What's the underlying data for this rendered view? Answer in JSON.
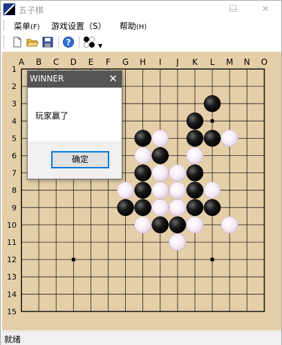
{
  "window": {
    "title": "五子棋",
    "minimize_glyph": "—",
    "maximize_glyph": "☐",
    "close_glyph": "✕"
  },
  "menubar": {
    "items": [
      {
        "label": "菜单",
        "accel": "(F)"
      },
      {
        "label": "游戏设置（S）",
        "accel": ""
      },
      {
        "label": "帮助",
        "accel": "(H)"
      }
    ]
  },
  "toolbar": {
    "buttons": [
      "new-file-icon",
      "open-folder-icon",
      "save-disk-icon",
      "help-icon",
      "gomoku-pieces-icon"
    ]
  },
  "board": {
    "columns": [
      "A",
      "B",
      "C",
      "D",
      "E",
      "F",
      "G",
      "H",
      "I",
      "J",
      "K",
      "L",
      "M",
      "N",
      "O"
    ],
    "rows": [
      "1",
      "2",
      "3",
      "4",
      "5",
      "6",
      "7",
      "8",
      "9",
      "10",
      "11",
      "12",
      "13",
      "14",
      "15"
    ],
    "star_points": [
      "D4",
      "L4",
      "D12",
      "L12"
    ],
    "black_stones": [
      "L3",
      "K4",
      "H5",
      "K5",
      "L5",
      "I6",
      "H7",
      "K7",
      "H8",
      "K8",
      "G9",
      "H9",
      "K9",
      "L9",
      "I10",
      "J10"
    ],
    "white_stones": [
      "I5",
      "M5",
      "H6",
      "K6",
      "I7",
      "J7",
      "G8",
      "I8",
      "J8",
      "L8",
      "I9",
      "J9",
      "H10",
      "K10",
      "M10",
      "J11"
    ],
    "colors": {
      "board": "#e5cfa8",
      "grid": "#1a1a1a",
      "black": "#111111",
      "white": "#f3e6f3"
    }
  },
  "dialog": {
    "title": "WINNER",
    "close_glyph": "✕",
    "message": "玩家赢了",
    "ok_label": "确定"
  },
  "status": {
    "text": "就绪"
  }
}
